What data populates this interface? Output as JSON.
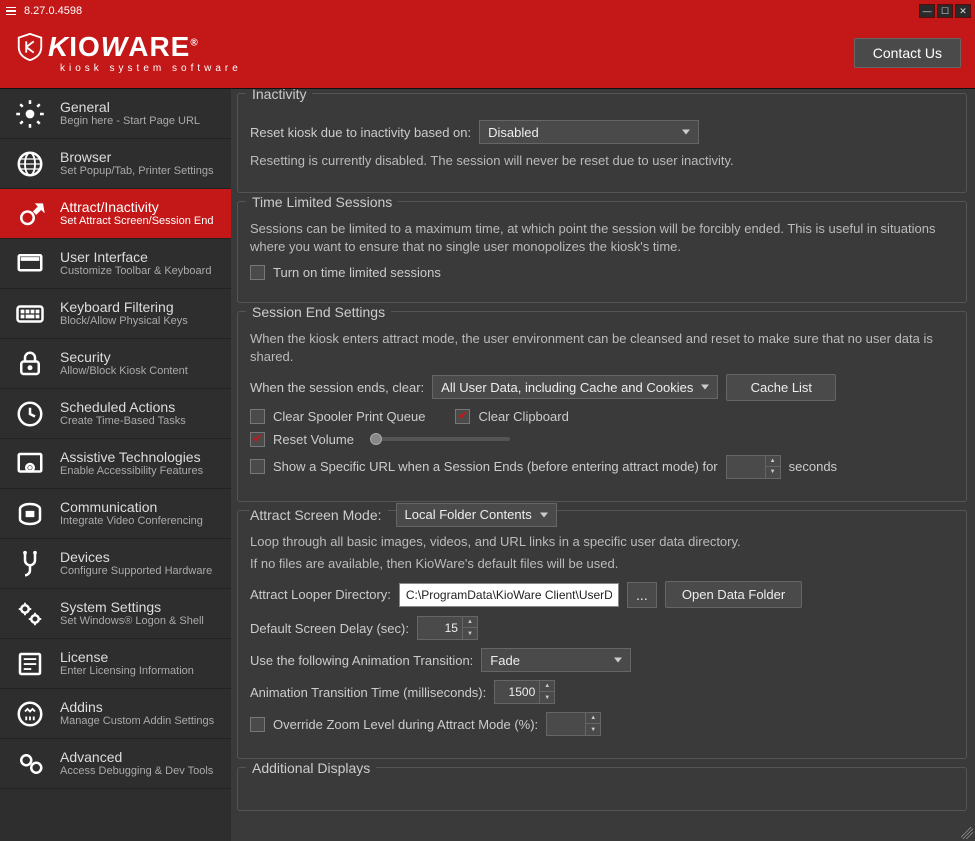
{
  "titlebar": {
    "version": "8.27.0.4598"
  },
  "header": {
    "logo_name": "KioWARE",
    "logo_sub": "kiosk system software",
    "contact": "Contact Us"
  },
  "sidebar": {
    "items": [
      {
        "title": "General",
        "sub": "Begin here - Start Page URL"
      },
      {
        "title": "Browser",
        "sub": "Set Popup/Tab, Printer Settings"
      },
      {
        "title": "Attract/Inactivity",
        "sub": "Set Attract Screen/Session End"
      },
      {
        "title": "User Interface",
        "sub": "Customize Toolbar & Keyboard"
      },
      {
        "title": "Keyboard Filtering",
        "sub": "Block/Allow Physical Keys"
      },
      {
        "title": "Security",
        "sub": "Allow/Block Kiosk Content"
      },
      {
        "title": "Scheduled Actions",
        "sub": "Create Time-Based Tasks"
      },
      {
        "title": "Assistive Technologies",
        "sub": "Enable Accessibility Features"
      },
      {
        "title": "Communication",
        "sub": "Integrate Video Conferencing"
      },
      {
        "title": "Devices",
        "sub": "Configure Supported Hardware"
      },
      {
        "title": "System Settings",
        "sub": "Set Windows® Logon & Shell"
      },
      {
        "title": "License",
        "sub": "Enter Licensing Information"
      },
      {
        "title": "Addins",
        "sub": "Manage Custom Addin Settings"
      },
      {
        "title": "Advanced",
        "sub": "Access Debugging & Dev Tools"
      }
    ]
  },
  "inactivity": {
    "title": "Inactivity",
    "reset_label": "Reset kiosk due to inactivity based on:",
    "reset_value": "Disabled",
    "desc": "Resetting is currently disabled. The session will never be reset due to user inactivity."
  },
  "time_limited": {
    "title": "Time Limited Sessions",
    "desc": "Sessions can be limited to a maximum time, at which point the session will be forcibly ended. This is useful in situations where you want to ensure that no single user monopolizes the kiosk's time.",
    "checkbox_label": "Turn on time limited sessions",
    "checked": false
  },
  "session_end": {
    "title": "Session End Settings",
    "desc": "When the kiosk enters attract mode, the user environment can be cleansed and reset to make sure that no user data is shared.",
    "clear_label": "When the session ends, clear:",
    "clear_value": "All User Data, including Cache and Cookies",
    "cache_list_btn": "Cache List",
    "clear_spooler": {
      "label": "Clear Spooler Print Queue",
      "checked": false
    },
    "clear_clipboard": {
      "label": "Clear Clipboard",
      "checked": true
    },
    "reset_volume": {
      "label": "Reset Volume",
      "checked": true
    },
    "show_url_prefix": "Show a Specific URL when a Session Ends (before entering attract mode) for",
    "show_url_seconds": "",
    "show_url_suffix": "seconds",
    "show_url_checked": false
  },
  "attract": {
    "title": "Attract Screen Mode:",
    "mode_value": "Local Folder Contents",
    "desc1": "Loop through all basic images, videos, and URL links in a specific user data directory.",
    "desc2": "If no files are available, then KioWare's default files will be used.",
    "dir_label": "Attract Looper Directory:",
    "dir_value": "C:\\ProgramData\\KioWare Client\\UserDat",
    "browse_btn": "...",
    "open_folder_btn": "Open Data Folder",
    "delay_label": "Default Screen Delay (sec):",
    "delay_value": "15",
    "transition_label": "Use the following Animation Transition:",
    "transition_value": "Fade",
    "transition_time_label": "Animation Transition Time (milliseconds):",
    "transition_time_value": "1500",
    "override_zoom_label": "Override Zoom Level during Attract Mode (%):",
    "override_zoom_checked": false,
    "override_zoom_value": ""
  },
  "additional": {
    "title": "Additional Displays"
  }
}
